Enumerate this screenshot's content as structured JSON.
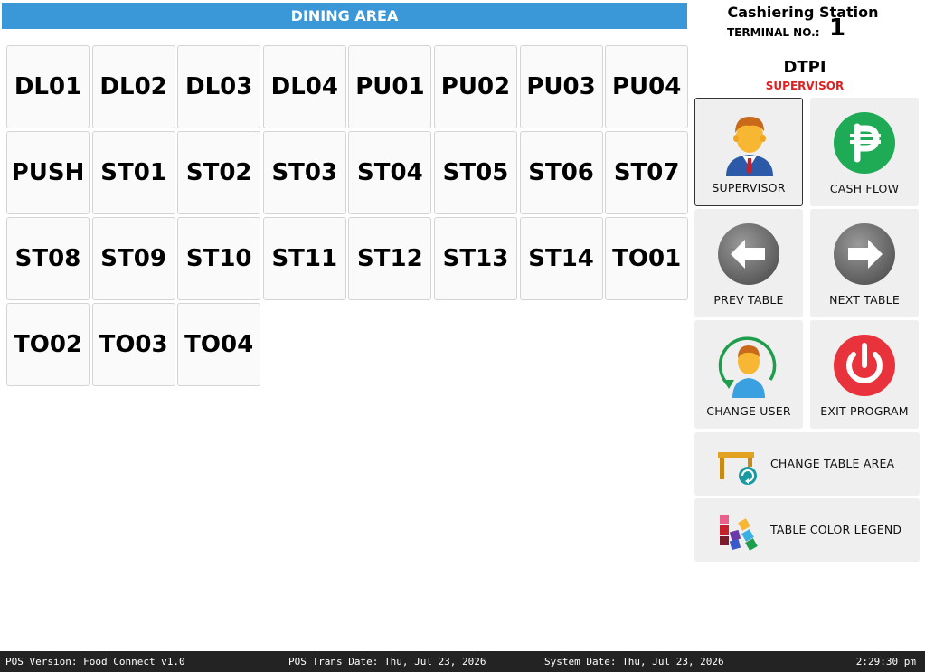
{
  "dining_area": {
    "title": "DINING AREA",
    "tables": [
      "DL01",
      "DL02",
      "DL03",
      "DL04",
      "PU01",
      "PU02",
      "PU03",
      "PU04",
      "PUSH",
      "ST01",
      "ST02",
      "ST03",
      "ST04",
      "ST05",
      "ST06",
      "ST07",
      "ST08",
      "ST09",
      "ST10",
      "ST11",
      "ST12",
      "ST13",
      "ST14",
      "TO01",
      "TO02",
      "TO03",
      "TO04"
    ]
  },
  "station": {
    "title": "Cashiering Station",
    "terminal_label": "TERMINAL NO.:",
    "terminal_no": "1",
    "user_name": "DTPI",
    "user_role": "SUPERVISOR"
  },
  "buttons": {
    "supervisor": "SUPERVISOR",
    "cash_flow": "CASH FLOW",
    "prev_table": "PREV TABLE",
    "next_table": "NEXT TABLE",
    "change_user": "CHANGE USER",
    "exit_program": "EXIT PROGRAM",
    "change_table_area": "CHANGE TABLE AREA",
    "table_color_legend": "TABLE COLOR LEGEND"
  },
  "colors": {
    "header_blue": "#3a98d8",
    "role_red": "#e02020",
    "cash_green": "#1faa55",
    "exit_red": "#e8333c",
    "status_bar": "#232323"
  },
  "icons": {
    "supervisor": "supervisor-person-icon",
    "cash_flow": "peso-coin-icon",
    "prev_table": "arrow-left-icon",
    "next_table": "arrow-right-icon",
    "change_user": "change-user-icon",
    "exit_program": "power-icon",
    "change_table_area": "table-refresh-icon",
    "table_color_legend": "color-swatch-icon"
  },
  "status_bar": {
    "version": "POS Version: Food Connect v1.0",
    "trans_date": "POS Trans Date: Thu, Jul 23, 2026",
    "system_date": "System Date: Thu, Jul 23, 2026",
    "time": "2:29:30 pm"
  }
}
